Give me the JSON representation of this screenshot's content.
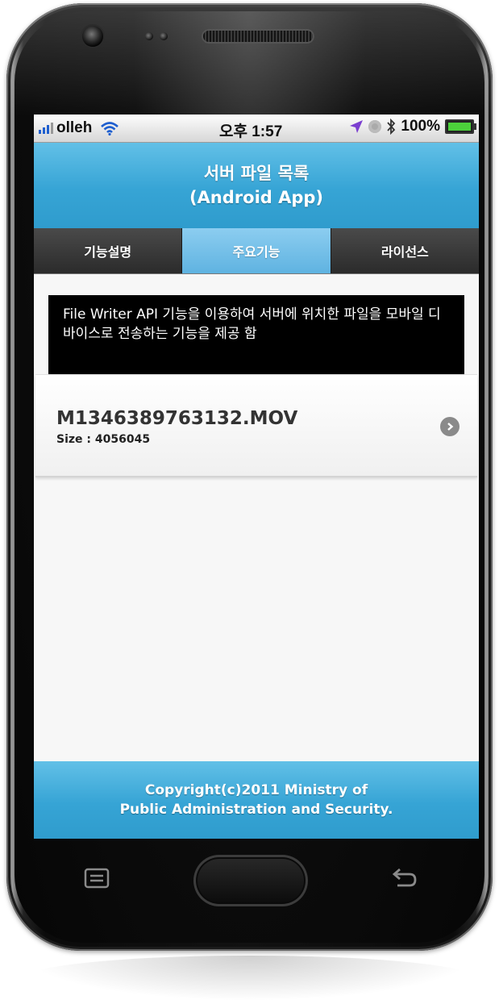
{
  "status_bar": {
    "carrier": "olleh",
    "time": "오후 1:57",
    "battery": "100%"
  },
  "header": {
    "title_line1": "서버 파일 목록",
    "title_line2": "(Android App)"
  },
  "tabs": [
    {
      "label": "기능설명",
      "active": false
    },
    {
      "label": "주요기능",
      "active": true
    },
    {
      "label": "라이선스",
      "active": false
    }
  ],
  "description": "File Writer API 기능을 이용하여 서버에 위치한 파일을 모바일 디바이스로 전송하는 기능을 제공 함",
  "files": [
    {
      "name": "M1346389763132.MOV",
      "size": "Size : 4056045"
    }
  ],
  "footer": {
    "line1": "Copyright(c)2011 Ministry of",
    "line2": "Public Administration and Security."
  },
  "colors": {
    "accent": "#36a4d5",
    "tab_active": "#6fbfe8",
    "tab_inactive": "#3a3a3a"
  }
}
